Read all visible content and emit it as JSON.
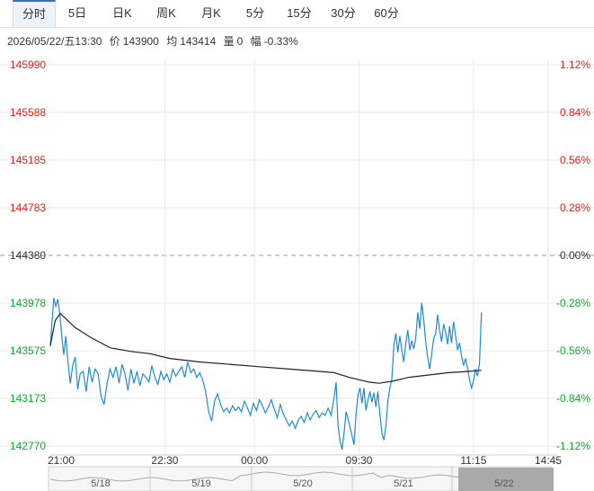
{
  "tabs": [
    {
      "label": "分时",
      "active": true
    },
    {
      "label": "5日",
      "active": false
    },
    {
      "label": "日K",
      "active": false
    },
    {
      "label": "周K",
      "active": false
    },
    {
      "label": "月K",
      "active": false
    },
    {
      "label": "5分",
      "active": false
    },
    {
      "label": "15分",
      "active": false
    },
    {
      "label": "30分",
      "active": false
    },
    {
      "label": "60分",
      "active": false
    }
  ],
  "info": {
    "datetime": "2026/05/22/五13:30",
    "price_label": "价",
    "price": "143900",
    "avg_label": "均",
    "avg": "143414",
    "volume_label": "量",
    "volume": "0",
    "change_label": "幅",
    "change": "-0.33%"
  },
  "colors": {
    "up": "#e4211c",
    "down": "#14a82f",
    "flat": "#333333",
    "price_line": "#1f8ccf",
    "avg_line": "#222222",
    "grid": "#eaeaea"
  },
  "chart_data": {
    "type": "line",
    "reference_price": 144380,
    "ylim": [
      142770,
      145990
    ],
    "left_ticks": [
      "145990",
      "145588",
      "145185",
      "144783",
      "144380",
      "143978",
      "143575",
      "143173",
      "142770"
    ],
    "left_tick_colors": [
      "up",
      "up",
      "up",
      "up",
      "flat",
      "down",
      "down",
      "down",
      "down"
    ],
    "right_ticks": [
      "1.12%",
      "0.84%",
      "0.56%",
      "0.28%",
      "0.00%",
      "-0.28%",
      "-0.56%",
      "-0.84%",
      "-1.12%"
    ],
    "x_ticks": [
      "21:00",
      "22:30",
      "00:00",
      "09:30",
      "11:15",
      "14:45"
    ],
    "x_tick_positions": [
      0,
      0.23,
      0.41,
      0.62,
      0.85,
      1.0
    ],
    "series": [
      {
        "name": "price",
        "values": [
          [
            0.0,
            143610
          ],
          [
            0.003,
            143800
          ],
          [
            0.007,
            144020
          ],
          [
            0.011,
            143950
          ],
          [
            0.015,
            144010
          ],
          [
            0.019,
            143890
          ],
          [
            0.023,
            143700
          ],
          [
            0.027,
            143540
          ],
          [
            0.031,
            143700
          ],
          [
            0.035,
            143500
          ],
          [
            0.04,
            143300
          ],
          [
            0.045,
            143450
          ],
          [
            0.05,
            143520
          ],
          [
            0.055,
            143250
          ],
          [
            0.06,
            143380
          ],
          [
            0.066,
            143400
          ],
          [
            0.072,
            143230
          ],
          [
            0.078,
            143440
          ],
          [
            0.084,
            143310
          ],
          [
            0.09,
            143420
          ],
          [
            0.096,
            143380
          ],
          [
            0.102,
            143190
          ],
          [
            0.108,
            143120
          ],
          [
            0.114,
            143300
          ],
          [
            0.12,
            143420
          ],
          [
            0.126,
            143350
          ],
          [
            0.132,
            143440
          ],
          [
            0.138,
            143300
          ],
          [
            0.144,
            143460
          ],
          [
            0.15,
            143380
          ],
          [
            0.156,
            143240
          ],
          [
            0.162,
            143420
          ],
          [
            0.168,
            143300
          ],
          [
            0.174,
            143400
          ],
          [
            0.18,
            143280
          ],
          [
            0.186,
            143380
          ],
          [
            0.192,
            143350
          ],
          [
            0.198,
            143310
          ],
          [
            0.204,
            143450
          ],
          [
            0.21,
            143350
          ],
          [
            0.216,
            143290
          ],
          [
            0.222,
            143400
          ],
          [
            0.228,
            143330
          ],
          [
            0.234,
            143380
          ],
          [
            0.24,
            143310
          ],
          [
            0.246,
            143420
          ],
          [
            0.252,
            143360
          ],
          [
            0.258,
            143400
          ],
          [
            0.264,
            143440
          ],
          [
            0.27,
            143350
          ],
          [
            0.276,
            143480
          ],
          [
            0.282,
            143390
          ],
          [
            0.288,
            143420
          ],
          [
            0.294,
            143350
          ],
          [
            0.3,
            143390
          ],
          [
            0.306,
            143330
          ],
          [
            0.312,
            143230
          ],
          [
            0.318,
            143060
          ],
          [
            0.324,
            142980
          ],
          [
            0.33,
            143150
          ],
          [
            0.336,
            143210
          ],
          [
            0.342,
            143120
          ],
          [
            0.348,
            143060
          ],
          [
            0.354,
            143090
          ],
          [
            0.36,
            143050
          ],
          [
            0.366,
            143110
          ],
          [
            0.372,
            143070
          ],
          [
            0.378,
            143100
          ],
          [
            0.384,
            143060
          ],
          [
            0.39,
            143150
          ],
          [
            0.396,
            143090
          ],
          [
            0.402,
            143030
          ],
          [
            0.408,
            143130
          ],
          [
            0.414,
            143070
          ],
          [
            0.42,
            143160
          ],
          [
            0.426,
            143110
          ],
          [
            0.432,
            143050
          ],
          [
            0.438,
            143100
          ],
          [
            0.444,
            143160
          ],
          [
            0.45,
            143080
          ],
          [
            0.456,
            143010
          ],
          [
            0.462,
            143120
          ],
          [
            0.468,
            143040
          ],
          [
            0.474,
            142990
          ],
          [
            0.48,
            142940
          ],
          [
            0.486,
            142980
          ],
          [
            0.492,
            142920
          ],
          [
            0.498,
            142990
          ],
          [
            0.504,
            143020
          ],
          [
            0.51,
            142970
          ],
          [
            0.516,
            143050
          ],
          [
            0.522,
            142990
          ],
          [
            0.528,
            143040
          ],
          [
            0.534,
            143070
          ],
          [
            0.54,
            143010
          ],
          [
            0.546,
            143050
          ],
          [
            0.552,
            143030
          ],
          [
            0.558,
            143090
          ],
          [
            0.564,
            143030
          ],
          [
            0.57,
            143180
          ],
          [
            0.574,
            143310
          ],
          [
            0.578,
            142940
          ],
          [
            0.582,
            142810
          ],
          [
            0.586,
            142740
          ],
          [
            0.59,
            142880
          ],
          [
            0.594,
            143060
          ],
          [
            0.598,
            143000
          ],
          [
            0.602,
            142930
          ],
          [
            0.606,
            142860
          ],
          [
            0.61,
            142780
          ],
          [
            0.614,
            143040
          ],
          [
            0.618,
            143200
          ],
          [
            0.622,
            143260
          ],
          [
            0.626,
            143130
          ],
          [
            0.63,
            143260
          ],
          [
            0.634,
            143070
          ],
          [
            0.638,
            143160
          ],
          [
            0.642,
            143230
          ],
          [
            0.646,
            143140
          ],
          [
            0.65,
            143220
          ],
          [
            0.654,
            143100
          ],
          [
            0.658,
            143230
          ],
          [
            0.662,
            143040
          ],
          [
            0.666,
            142880
          ],
          [
            0.67,
            142820
          ],
          [
            0.674,
            142940
          ],
          [
            0.678,
            143150
          ],
          [
            0.682,
            143260
          ],
          [
            0.686,
            143330
          ],
          [
            0.69,
            143620
          ],
          [
            0.694,
            143720
          ],
          [
            0.698,
            143560
          ],
          [
            0.702,
            143700
          ],
          [
            0.706,
            143580
          ],
          [
            0.71,
            143480
          ],
          [
            0.714,
            143640
          ],
          [
            0.718,
            143750
          ],
          [
            0.722,
            143580
          ],
          [
            0.726,
            143660
          ],
          [
            0.73,
            143590
          ],
          [
            0.734,
            143680
          ],
          [
            0.738,
            143900
          ],
          [
            0.742,
            143760
          ],
          [
            0.746,
            143980
          ],
          [
            0.75,
            143840
          ],
          [
            0.754,
            143650
          ],
          [
            0.758,
            143520
          ],
          [
            0.762,
            143420
          ],
          [
            0.766,
            143550
          ],
          [
            0.77,
            143680
          ],
          [
            0.774,
            143720
          ],
          [
            0.778,
            143880
          ],
          [
            0.782,
            143750
          ],
          [
            0.786,
            143650
          ],
          [
            0.79,
            143800
          ],
          [
            0.794,
            143730
          ],
          [
            0.798,
            143630
          ],
          [
            0.802,
            143780
          ],
          [
            0.806,
            143640
          ],
          [
            0.81,
            143820
          ],
          [
            0.814,
            143700
          ],
          [
            0.818,
            143580
          ],
          [
            0.822,
            143640
          ],
          [
            0.826,
            143530
          ],
          [
            0.83,
            143450
          ],
          [
            0.834,
            143510
          ],
          [
            0.838,
            143430
          ],
          [
            0.842,
            143330
          ],
          [
            0.846,
            143260
          ],
          [
            0.85,
            143320
          ],
          [
            0.854,
            143420
          ],
          [
            0.858,
            143360
          ],
          [
            0.862,
            143460
          ],
          [
            0.866,
            143900
          ]
        ]
      },
      {
        "name": "avg",
        "values": [
          [
            0.0,
            143620
          ],
          [
            0.01,
            143830
          ],
          [
            0.02,
            143890
          ],
          [
            0.035,
            143830
          ],
          [
            0.05,
            143770
          ],
          [
            0.08,
            143690
          ],
          [
            0.12,
            143600
          ],
          [
            0.16,
            143570
          ],
          [
            0.2,
            143550
          ],
          [
            0.24,
            143510
          ],
          [
            0.3,
            143480
          ],
          [
            0.36,
            143460
          ],
          [
            0.42,
            143440
          ],
          [
            0.48,
            143420
          ],
          [
            0.54,
            143400
          ],
          [
            0.57,
            143390
          ],
          [
            0.6,
            143350
          ],
          [
            0.64,
            143310
          ],
          [
            0.66,
            143300
          ],
          [
            0.69,
            143320
          ],
          [
            0.72,
            143350
          ],
          [
            0.76,
            143370
          ],
          [
            0.8,
            143390
          ],
          [
            0.84,
            143400
          ],
          [
            0.866,
            143410
          ]
        ]
      }
    ],
    "navigator": {
      "labels": [
        "5/18",
        "5/19",
        "5/20",
        "5/21",
        "5/22"
      ]
    }
  }
}
